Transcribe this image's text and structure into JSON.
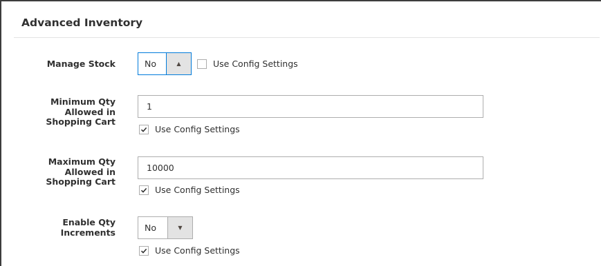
{
  "section": {
    "title": "Advanced Inventory"
  },
  "manage_stock": {
    "label": "Manage Stock",
    "value": "No",
    "arrow": "▲",
    "use_config_label": "Use Config Settings",
    "use_config_checked": false
  },
  "min_qty": {
    "label_lines": [
      "Minimum Qty",
      "Allowed in",
      "Shopping Cart"
    ],
    "value": "1",
    "use_config_label": "Use Config Settings",
    "use_config_checked": true
  },
  "max_qty": {
    "label_lines": [
      "Maximum Qty",
      "Allowed in",
      "Shopping Cart"
    ],
    "value": "10000",
    "use_config_label": "Use Config Settings",
    "use_config_checked": true
  },
  "qty_increments": {
    "label_lines": [
      "Enable Qty",
      "Increments"
    ],
    "value": "No",
    "arrow": "▼",
    "use_config_label": "Use Config Settings",
    "use_config_checked": true
  },
  "icons": {
    "checkbox_checked": "checkmark-icon",
    "select_open": "caret-up-icon",
    "select_closed": "caret-down-icon"
  }
}
